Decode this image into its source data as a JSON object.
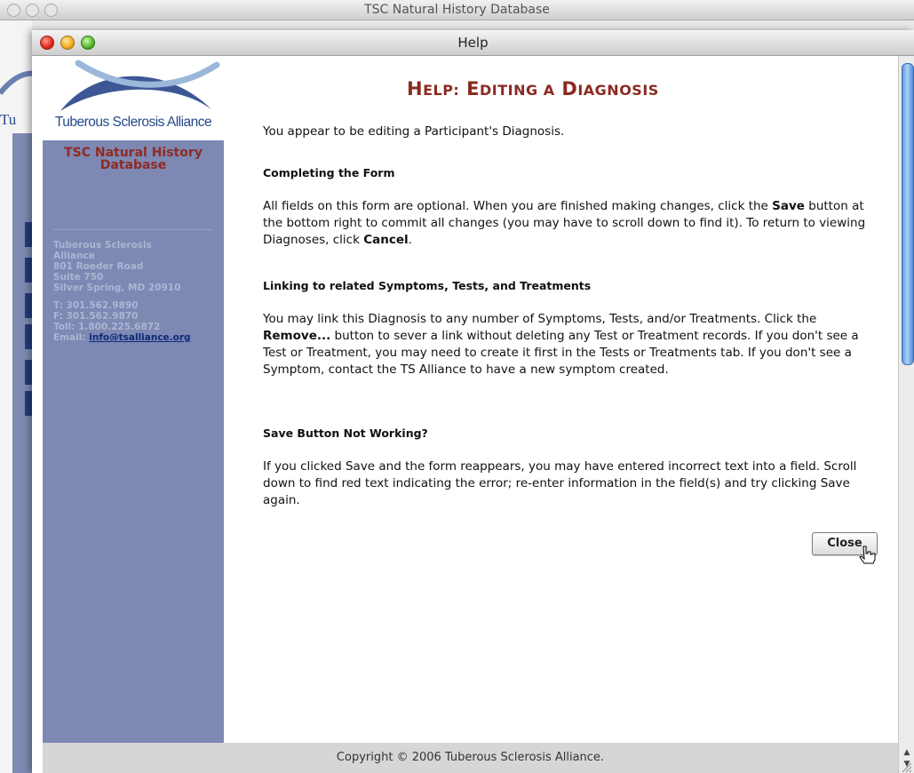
{
  "background_window": {
    "title": "TSC Natural History Database",
    "logo_fragment": "Tu"
  },
  "help_window": {
    "title": "Help"
  },
  "sidebar": {
    "org_name": "Tuberous Sclerosis Alliance",
    "db_name_line1": "TSC Natural History",
    "db_name_line2": "Database",
    "address_line1": "Tuberous Sclerosis",
    "address_line2": "Alliance",
    "address_line3": "801 Roeder Road",
    "address_line4": "Suite 750",
    "address_line5": "Silver Spring, MD 20910",
    "phone": "T: 301.562.9890",
    "fax": "F: 301.562.9870",
    "tollfree": "Toll: 1.800.225.6872",
    "email_label": "Email:",
    "email_link": "info@tsalliance.org"
  },
  "content": {
    "heading_big1": "H",
    "heading_small1": "ELP:",
    "heading_big2": "E",
    "heading_small2": "DITING A",
    "heading_big3": "D",
    "heading_small3": "IAGNOSIS",
    "intro": "You appear to be editing a Participant's Diagnosis.",
    "section1_title": "Completing the Form",
    "section1_a": "All fields on this form are optional. When you are finished making changes, click the ",
    "section1_save": "Save",
    "section1_b": " button at the bottom right to commit all changes (you may have to scroll down to find it). To return to viewing Diagnoses, click ",
    "section1_cancel": "Cancel",
    "section1_c": ".",
    "section2_title": "Linking to related Symptoms, Tests, and Treatments",
    "section2_a": "You may link this Diagnosis to any number of Symptoms, Tests, and/or Treatments. Click the ",
    "section2_remove": "Remove...",
    "section2_b": " button to sever a link without deleting any Test or Treatment records. If you don't see a Test or Treatment, you may need to create it first in the Tests or Treatments tab. If you don't see a Symptom, contact the TS Alliance to have a new symptom created.",
    "section3_title": "Save Button Not Working?",
    "section3_text": "If you clicked Save and the form reappears, you may have entered incorrect text into a field. Scroll down to find red text indicating the error; re-enter information in the field(s) and try clicking Save again."
  },
  "close_button_label": "Close",
  "footer_text": "Copyright © 2006 Tuberous Sclerosis Alliance.",
  "colors": {
    "heading": "#8b2a22",
    "sidebar": "#7d88b3",
    "link": "#102a7a"
  }
}
